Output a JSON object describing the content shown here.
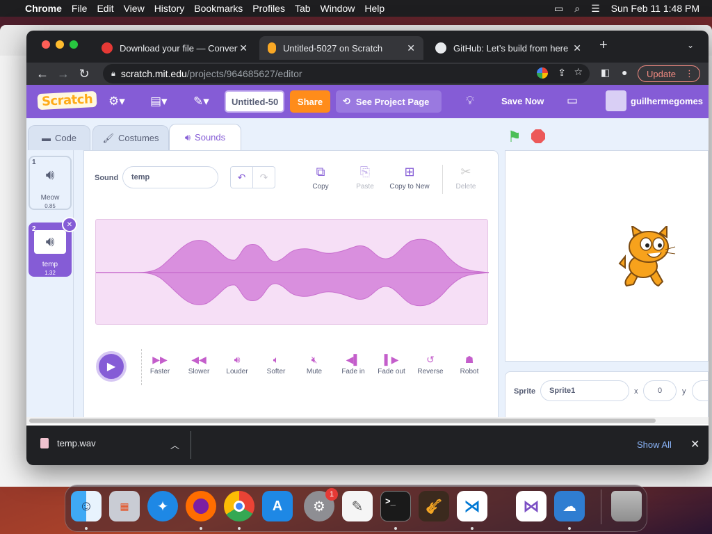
{
  "menubar": {
    "apple": "",
    "app": "Chrome",
    "items": [
      "File",
      "Edit",
      "View",
      "History",
      "Bookmarks",
      "Profiles",
      "Tab",
      "Window",
      "Help"
    ],
    "datetime": "Sun Feb 11  1:48 PM"
  },
  "browser": {
    "tabs": [
      {
        "title": "Download your file — Convertio",
        "close": "✕"
      },
      {
        "title": "Untitled-5027 on Scratch",
        "close": "✕"
      },
      {
        "title": "GitHub: Let’s build from here · GitHub",
        "close": "✕"
      }
    ],
    "new_tab": "+",
    "url_host": "scratch.mit.edu",
    "url_path": "/projects/964685627/editor",
    "update_label": "Update"
  },
  "scratch": {
    "logo": "Scratch",
    "project_title": "Untitled-50",
    "share_label": "Share",
    "see_project_label": "See Project Page",
    "save_label": "Save Now",
    "username": "guilhermegomes",
    "tabs": {
      "code": "Code",
      "costumes": "Costumes",
      "sounds": "Sounds"
    },
    "sounds": [
      {
        "num": "1",
        "name": "Meow",
        "duration": "0.85"
      },
      {
        "num": "2",
        "name": "temp",
        "duration": "1.32"
      }
    ],
    "editor": {
      "sound_label": "Sound",
      "sound_name": "temp",
      "tools": {
        "copy": "Copy",
        "paste": "Paste",
        "copy_to_new": "Copy to New",
        "delete": "Delete"
      },
      "effects": [
        "Faster",
        "Slower",
        "Louder",
        "Softer",
        "Mute",
        "Fade in",
        "Fade out",
        "Reverse",
        "Robot"
      ]
    },
    "sprite": {
      "label": "Sprite",
      "name": "Sprite1",
      "x_label": "x",
      "x": "0",
      "y_label": "y"
    }
  },
  "downloads": {
    "file": "temp.wav",
    "show_all": "Show All"
  },
  "colors": {
    "scratch_purple": "#855cd6",
    "share_orange": "#ff8c1a",
    "wave": "#d98fde"
  }
}
